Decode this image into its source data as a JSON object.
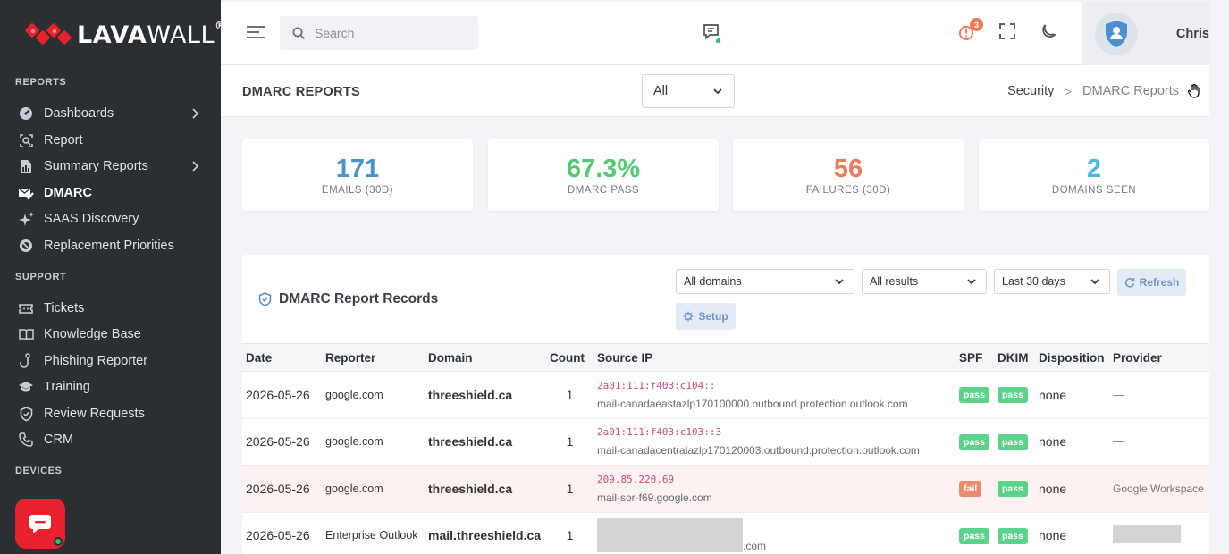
{
  "brand": {
    "name_bold": "LAVA",
    "name_thin": "WALL",
    "reg": "®"
  },
  "sidebar": {
    "sections": [
      {
        "title": "REPORTS"
      },
      {
        "title": "SUPPORT"
      },
      {
        "title": "DEVICES"
      }
    ],
    "items": [
      {
        "label": "Dashboards",
        "icon": "dashboard-icon"
      },
      {
        "label": "Report",
        "icon": "report-icon"
      },
      {
        "label": "Summary Reports",
        "icon": "summary-icon"
      },
      {
        "label": "DMARC",
        "icon": "dmarc-icon"
      },
      {
        "label": "SAAS Discovery",
        "icon": "sparkle-icon"
      },
      {
        "label": "Replacement Priorities",
        "icon": "priority-icon"
      },
      {
        "label": "Tickets",
        "icon": "ticket-icon"
      },
      {
        "label": "Knowledge Base",
        "icon": "book-icon"
      },
      {
        "label": "Phishing Reporter",
        "icon": "hook-icon"
      },
      {
        "label": "Training",
        "icon": "graduation-icon"
      },
      {
        "label": "Review Requests",
        "icon": "shield-check-icon"
      },
      {
        "label": "CRM",
        "icon": "phone-icon"
      }
    ]
  },
  "topbar": {
    "search_placeholder": "Search",
    "notification_count": "3",
    "user_name": "Chris"
  },
  "page": {
    "title": "DMARC REPORTS",
    "filter_value": "All",
    "breadcrumb": {
      "parent": "Security",
      "current": "DMARC Reports"
    }
  },
  "stats": [
    {
      "value": "171",
      "label": "EMAILS (30D)",
      "color": "#4a92c9"
    },
    {
      "value": "67.3%",
      "label": "DMARC PASS",
      "color": "#56c874"
    },
    {
      "value": "56",
      "label": "FAILURES (30D)",
      "color": "#ef7b5f"
    },
    {
      "value": "2",
      "label": "DOMAINS SEEN",
      "color": "#4cb7e5"
    }
  ],
  "records": {
    "title": "DMARC Report Records",
    "filters": {
      "domains": "All domains",
      "results": "All results",
      "range": "Last 30 days"
    },
    "refresh_label": "Refresh",
    "setup_label": "Setup",
    "columns": [
      "Date",
      "Reporter",
      "Domain",
      "Count",
      "Source IP",
      "SPF",
      "DKIM",
      "Disposition",
      "Provider"
    ],
    "rows": [
      {
        "date": "2026-05-26",
        "reporter": "google.com",
        "domain": "threeshield.ca",
        "count": "1",
        "ip": "2a01:111:f403:c104::",
        "host": "mail-canadaeastazlp170100000.outbound.protection.outlook.com",
        "spf": "pass",
        "dkim": "pass",
        "disposition": "none",
        "provider": "—"
      },
      {
        "date": "2026-05-26",
        "reporter": "google.com",
        "domain": "threeshield.ca",
        "count": "1",
        "ip": "2a01:111:f403:c103::3",
        "host": "mail-canadacentralazlp170120003.outbound.protection.outlook.com",
        "spf": "pass",
        "dkim": "pass",
        "disposition": "none",
        "provider": "—"
      },
      {
        "date": "2026-05-26",
        "reporter": "google.com",
        "domain": "threeshield.ca",
        "count": "1",
        "ip": "209.85.220.69",
        "host": "mail-sor-f69.google.com",
        "spf": "fail",
        "dkim": "pass",
        "disposition": "none",
        "provider": "Google Workspace"
      },
      {
        "date": "2026-05-26",
        "reporter": "Enterprise Outlook",
        "domain": "mail.threeshield.ca",
        "count": "1",
        "ip": "",
        "host": ".com",
        "spf": "pass",
        "dkim": "pass",
        "disposition": "none",
        "provider": ""
      }
    ]
  },
  "colors": {
    "sidebar_bg": "#2b2e33",
    "accent_red": "#e8222c",
    "pass_green": "#5bd38a",
    "fail_orange": "#f08a6c"
  }
}
